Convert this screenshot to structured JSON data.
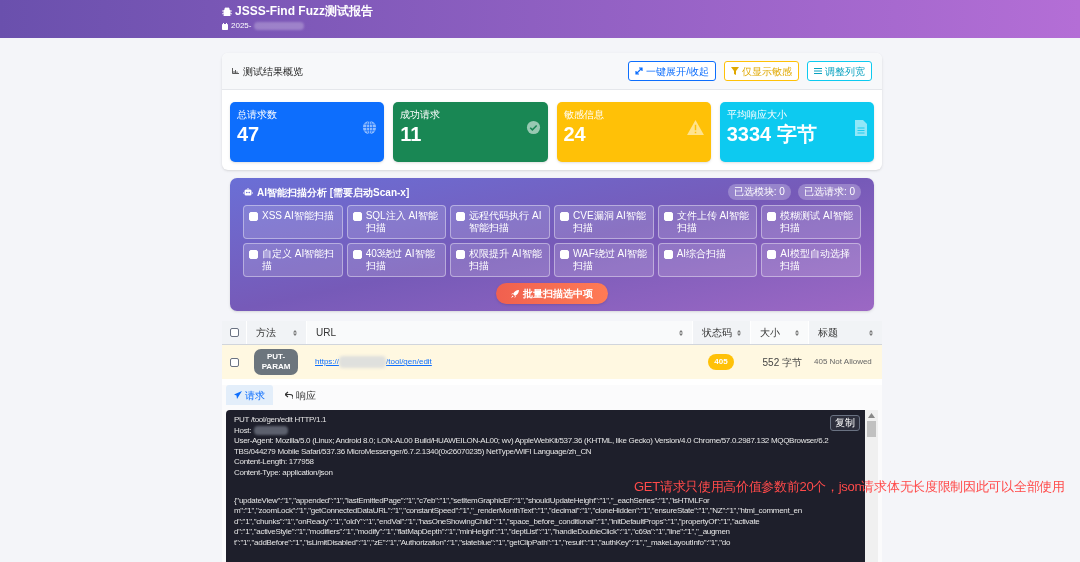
{
  "header": {
    "title": "JSSS-Find Fuzz测试报告",
    "date": "2025-"
  },
  "overview": {
    "title": "测试结果概览",
    "actions": [
      {
        "label": "一键展开/收起",
        "kind": "expand"
      },
      {
        "label": "仅显示敏感",
        "kind": "filter"
      },
      {
        "label": "调整列宽",
        "kind": "columns"
      }
    ]
  },
  "stats": [
    {
      "label": "总请求数",
      "value": "47",
      "kind": "globe",
      "color": "#0d6efd"
    },
    {
      "label": "成功请求",
      "value": "11",
      "kind": "check",
      "color": "#198754"
    },
    {
      "label": "敏感信息",
      "value": "24",
      "kind": "warning",
      "color": "#ffc107"
    },
    {
      "label": "平均响应大小",
      "value": "3334 字节",
      "kind": "file",
      "color": "#0dcaf0"
    }
  ],
  "ai_panel": {
    "title": "AI智能扫描分析 [需要启动Scan-x]",
    "badges": [
      "已选模块: 0",
      "已选请求: 0"
    ],
    "modules": [
      {
        "label": "XSS AI智能扫描",
        "checked": false
      },
      {
        "label": "SQL注入 AI智能扫描",
        "checked": false
      },
      {
        "label": "远程代码执行 AI智能扫描",
        "checked": false
      },
      {
        "label": "CVE漏洞 AI智能扫描",
        "checked": false
      },
      {
        "label": "文件上传 AI智能扫描",
        "checked": false
      },
      {
        "label": "模糊测试 AI智能扫描",
        "checked": false
      },
      {
        "label": "自定义 AI智能扫描",
        "checked": false
      },
      {
        "label": "403绕过 AI智能扫描",
        "checked": false
      },
      {
        "label": "权限提升 AI智能扫描",
        "checked": false
      },
      {
        "label": "WAF绕过 AI智能扫描",
        "checked": false
      },
      {
        "label": "AI综合扫描",
        "checked": false
      },
      {
        "label": "AI模型自动选择扫描",
        "checked": false
      }
    ],
    "button": "批量扫描选中项"
  },
  "table": {
    "select_all": {
      "checked": false
    },
    "columns": [
      "方法",
      "URL",
      "状态码",
      "大小",
      "标题"
    ],
    "rows": [
      {
        "checked": false,
        "method": "PUT-PARAM",
        "url_start": "https://",
        "url_end": "/tool/gen/edit",
        "status": "405",
        "size": "552 字节",
        "title": "405 Not Allowed"
      }
    ]
  },
  "detail_tabs": [
    {
      "label": "请求",
      "kind": "send",
      "selected": true
    },
    {
      "label": "响应",
      "kind": "reply",
      "selected": false
    }
  ],
  "code": {
    "copy": "复制",
    "head": [
      "PUT /tool/gen/edit HTTP/1.1",
      "Host:",
      "User-Agent: Mozilla/5.0 (Linux; Android 8.0; LON-AL00 Build/HUAWEILON-AL00; wv) AppleWebKit/537.36 (KHTML, like Gecko) Version/4.0 Chrome/57.0.2987.132 MQQBrowser/6.2",
      "TBS/044279 Mobile Safari/537.36 MicroMessenger/6.7.2.1340(0x26070235) NetType/WIFI Language/zh_CN",
      "Content-Length: 177958",
      "Content-Type: application/json"
    ],
    "body": [
      "{\"updateView\":\"1\",\"appended\":\"1\",\"lastEmittedPage\":\"1\",\"c7eb\":\"1\",\"setItemGraphicEl\":\"1\",\"shouldUpdateHeight\":\"1\",\"_eachSeries\":\"1\",\"isHTMLFor",
      "m\":\"1\",\"zoomLock\":\"1\",\"getConnectedDataURL\":\"1\",\"constantSpeed\":\"1\",\"_renderMonthText\":\"1\",\"decimal\":\"1\",\"cloneHidden\":\"1\",\"ensureState\":\"1\",\"NZ\":\"1\",\"html_comment_en",
      "d\":\"1\",\"chunks\":\"1\",\"onReady\":\"1\",\"oldY\":\"1\",\"endVal\":\"1\",\"hasOneShowingChild\":\"1\",\"space_before_conditional\":\"1\",\"initDefaultProps\":\"1\",\"propertyOf\":\"1\",\"activate",
      "d\":\"1\",\"activeStyle\":\"1\",\"modifiers\":\"1\",\"modify\":\"1\",\"flatMapDepth\":\"1\",\"minHeight\":\"1\",\"deptList\":\"1\",\"handleDoubleClick\":\"1\",\"c69a\":\"1\",\"line\":\"1\",\"_augmen",
      "t\":\"1\",\"addBefore\":\"1\",\"isLimitDisabled\":\"1\",\"zE\":\"1\",\"Authorization\":\"1\",\"slateblue\":\"1\",\"getClipPath\":\"1\",\"result\":\"1\",\"authKey\":\"1\",\"_makeLayoutInfo\":\"1\",\"do"
    ]
  },
  "annotation": "GET请求只使用高价值参数前20个，json请求体无长度限制因此可以全部使用"
}
